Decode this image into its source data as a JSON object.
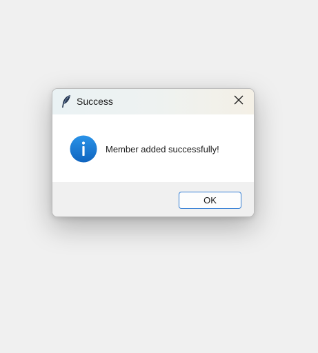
{
  "dialog": {
    "title": "Success",
    "app_icon": "feather-icon",
    "close_icon": "close-icon",
    "info_icon": "info-icon",
    "message": "Member added successfully!",
    "ok_label": "OK"
  },
  "colors": {
    "accent": "#2f7bd3",
    "info_icon_blue": "#1a7ad4",
    "content_bg": "#ffffff",
    "footer_bg": "#f0f0f0"
  }
}
